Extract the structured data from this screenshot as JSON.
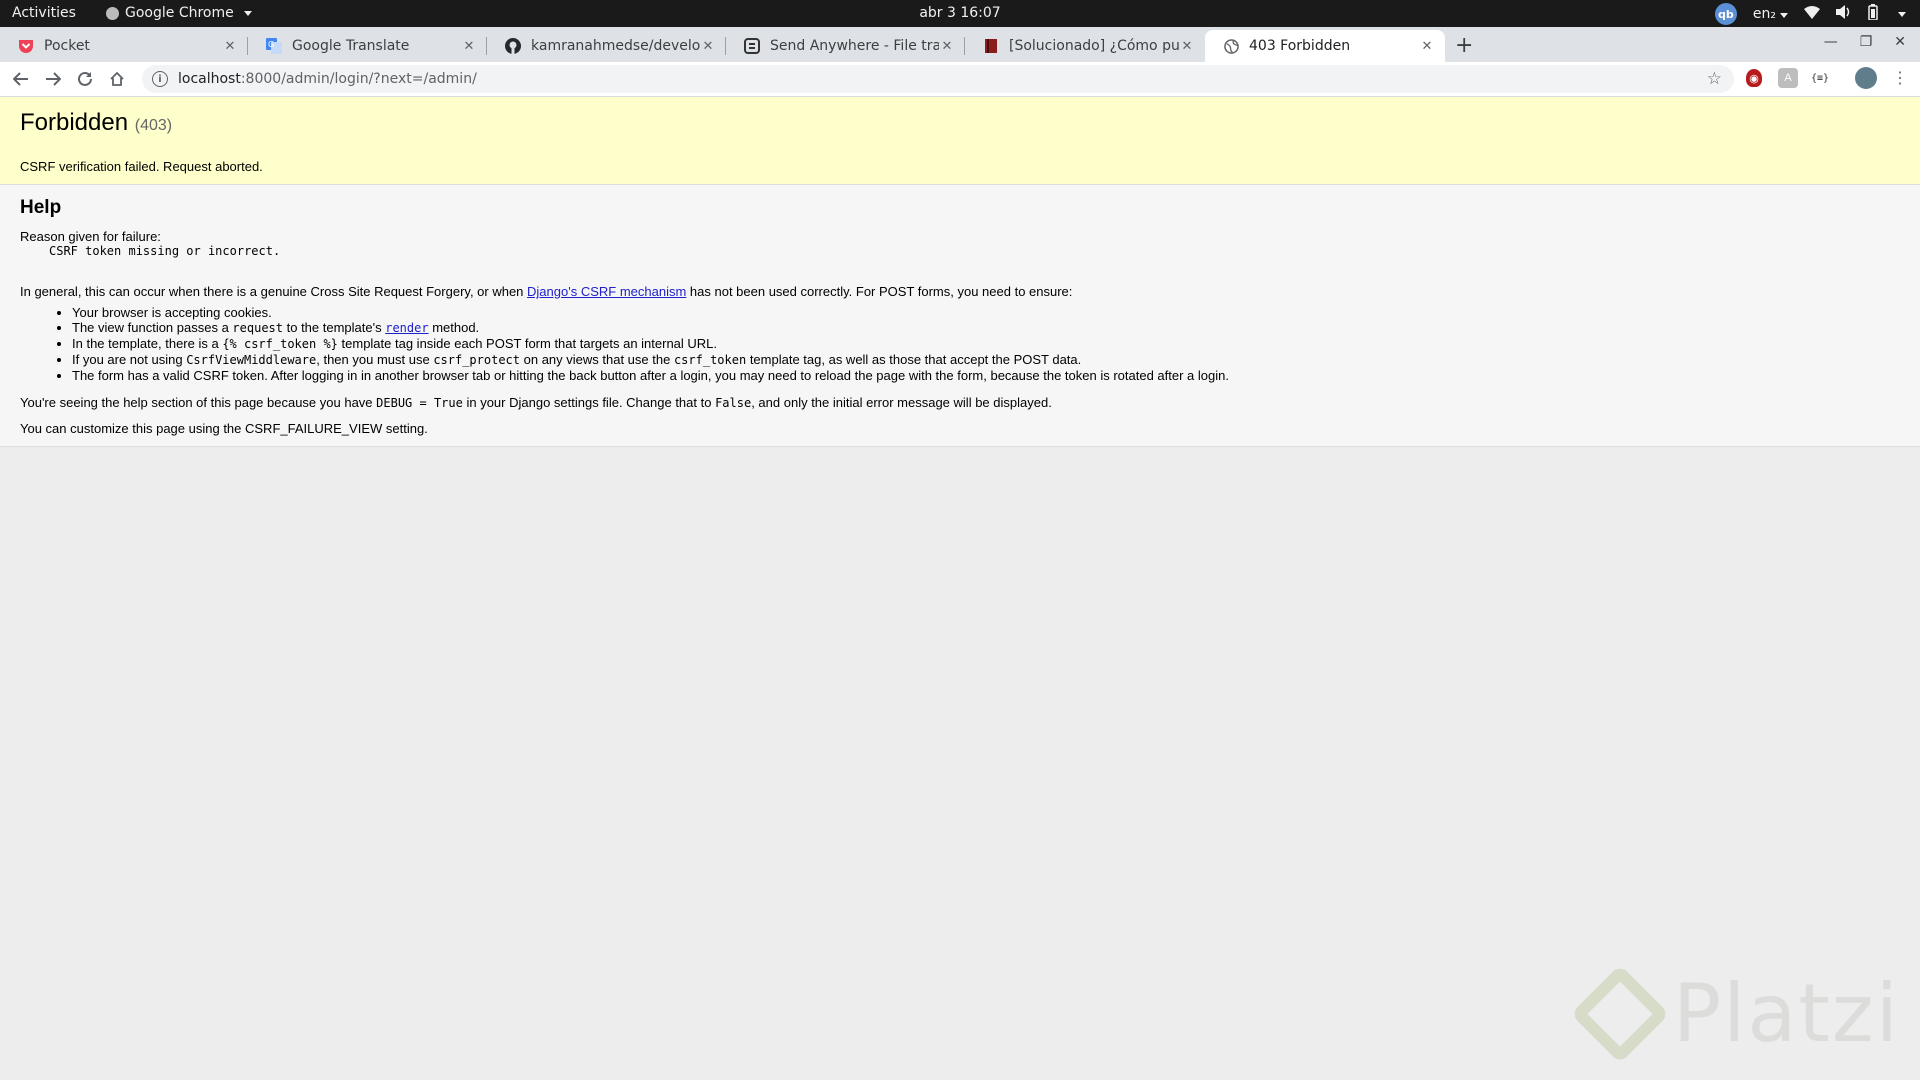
{
  "system": {
    "activities": "Activities",
    "app": "Google Chrome",
    "clock": "abr 3  16:07",
    "avatar": "qb",
    "lang": "en₂"
  },
  "tabs": [
    {
      "label": "Pocket",
      "icon": "pocket-icon",
      "color": "#ef4056"
    },
    {
      "label": "Google Translate",
      "icon": "translate-icon",
      "color": "#4285f4"
    },
    {
      "label": "kamranahmedse/develop",
      "icon": "github-icon",
      "color": "#24292e"
    },
    {
      "label": "Send Anywhere - File tran",
      "icon": "send-anywhere-icon",
      "color": "#333333"
    },
    {
      "label": "[Solucionado] ¿Cómo pue",
      "icon": "book-icon",
      "color": "#8b1d1d"
    },
    {
      "label": "403 Forbidden",
      "icon": "globe-icon",
      "color": "#5f6368",
      "active": true
    }
  ],
  "address": {
    "host": "localhost",
    "path": ":8000/admin/login/?next=/admin/"
  },
  "page": {
    "title": "Forbidden",
    "code": "(403)",
    "message": "CSRF verification failed. Request aborted.",
    "help_heading": "Help",
    "reason_label": "Reason given for failure:",
    "reason": "CSRF token missing or incorrect.",
    "general_pre": "In general, this can occur when there is a genuine Cross Site Request Forgery, or when ",
    "general_link": "Django's CSRF mechanism",
    "general_post": " has not been used correctly. For POST forms, you need to ensure:",
    "items": {
      "i1": "Your browser is accepting cookies.",
      "i2a": "The view function passes a ",
      "i2code": "request",
      "i2b": " to the template's ",
      "i2link": "render",
      "i2c": " method.",
      "i3a": "In the template, there is a ",
      "i3code": "{% csrf_token %}",
      "i3b": " template tag inside each POST form that targets an internal URL.",
      "i4a": "If you are not using ",
      "i4code1": "CsrfViewMiddleware",
      "i4b": ", then you must use ",
      "i4code2": "csrf_protect",
      "i4c": " on any views that use the ",
      "i4code3": "csrf_token",
      "i4d": " template tag, as well as those that accept the POST data.",
      "i5": "The form has a valid CSRF token. After logging in in another browser tab or hitting the back button after a login, you may need to reload the page with the form, because the token is rotated after a login."
    },
    "debug_a": "You're seeing the help section of this page because you have ",
    "debug_code1": "DEBUG = True",
    "debug_b": " in your Django settings file. Change that to ",
    "debug_code2": "False",
    "debug_c": ", and only the initial error message will be displayed.",
    "customize": "You can customize this page using the CSRF_FAILURE_VIEW setting."
  },
  "watermark": "Platzi"
}
